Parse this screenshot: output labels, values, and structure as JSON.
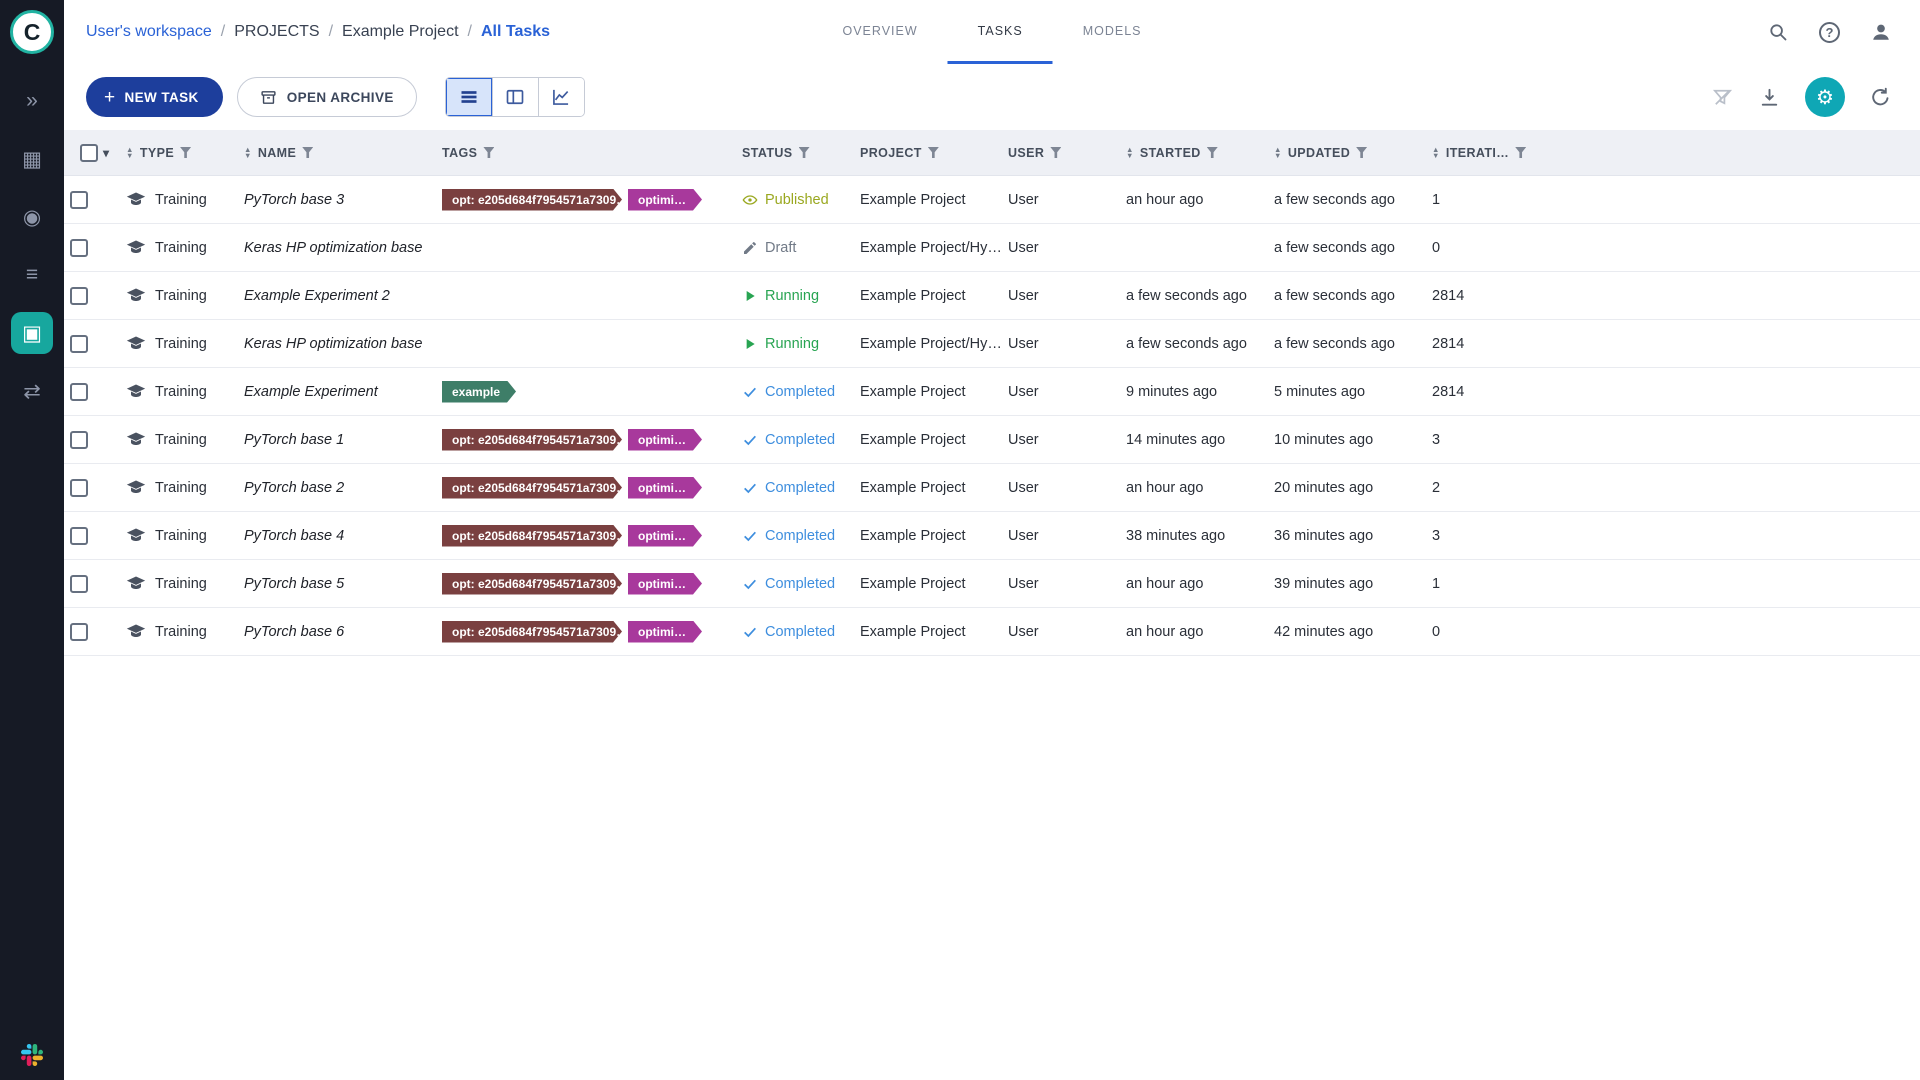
{
  "colors": {
    "sidebar_bg": "#161a25",
    "active_nav_teal": "#17a79e",
    "accent_blue": "#2a62d6",
    "primary_button_blue": "#1d3e9c",
    "gear_teal": "#0fa7b5",
    "tag_maroon": "#7a4040",
    "tag_magenta": "#a8399c",
    "tag_green": "#3e7e68",
    "status_published": "#9aa820",
    "status_draft": "#717a87",
    "status_running": "#28a452",
    "status_completed": "#3e8ede",
    "table_header_bg": "#eef0f5"
  },
  "icons": {
    "plus": "+",
    "caret_down": "▾",
    "sort_up": "▲",
    "sort_down": "▼",
    "help_mark": "?",
    "gear": "⚙"
  },
  "sidebar": {
    "logo_letter": "C",
    "items": [
      {
        "id": "expand",
        "glyph": "»"
      },
      {
        "id": "dashboard",
        "glyph": "▦"
      },
      {
        "id": "projects",
        "glyph": "◉"
      },
      {
        "id": "datasets",
        "glyph": "≡"
      },
      {
        "id": "pipelines",
        "glyph": "▣",
        "active": true
      },
      {
        "id": "workers-queues",
        "glyph": "⇄"
      }
    ]
  },
  "header": {
    "breadcrumb": {
      "separator": "/",
      "items": [
        {
          "label": "User's workspace"
        },
        {
          "label": "PROJECTS"
        },
        {
          "label": "Example Project"
        },
        {
          "label": "All Tasks"
        }
      ]
    },
    "tabs": [
      {
        "label": "OVERVIEW"
      },
      {
        "label": "TASKS"
      },
      {
        "label": "MODELS"
      }
    ],
    "active_tab": "TASKS"
  },
  "toolbar": {
    "new_task_label": "NEW TASK",
    "open_archive_label": "OPEN ARCHIVE"
  },
  "table": {
    "columns": [
      {
        "label": "TYPE"
      },
      {
        "label": "NAME"
      },
      {
        "label": "TAGS"
      },
      {
        "label": "STATUS"
      },
      {
        "label": "PROJECT"
      },
      {
        "label": "USER"
      },
      {
        "label": "STARTED"
      },
      {
        "label": "UPDATED"
      },
      {
        "label": "ITERATI…"
      }
    ],
    "rows": [
      {
        "type": "Training",
        "name": "PyTorch base 3",
        "tags": [
          {
            "label": "opt: e205d684f7954571a7309…",
            "variant": "maroon"
          },
          {
            "label": "optimi…",
            "variant": "magenta"
          }
        ],
        "status": {
          "label": "Published",
          "kind": "published"
        },
        "project": "Example Project",
        "user": "User",
        "started": "an hour ago",
        "updated": "a few seconds ago",
        "iterations": 1
      },
      {
        "type": "Training",
        "name": "Keras HP optimization base",
        "tags": [],
        "status": {
          "label": "Draft",
          "kind": "draft"
        },
        "project": "Example Project/Hy…",
        "user": "User",
        "started": "",
        "updated": "a few seconds ago",
        "iterations": 0
      },
      {
        "type": "Training",
        "name": "Example Experiment 2",
        "tags": [],
        "status": {
          "label": "Running",
          "kind": "running"
        },
        "project": "Example Project",
        "user": "User",
        "started": "a few seconds ago",
        "updated": "a few seconds ago",
        "iterations": 2814
      },
      {
        "type": "Training",
        "name": "Keras HP optimization base",
        "tags": [],
        "status": {
          "label": "Running",
          "kind": "running"
        },
        "project": "Example Project/Hy…",
        "user": "User",
        "started": "a few seconds ago",
        "updated": "a few seconds ago",
        "iterations": 2814
      },
      {
        "type": "Training",
        "name": "Example Experiment",
        "tags": [
          {
            "label": "example",
            "variant": "green"
          }
        ],
        "status": {
          "label": "Completed",
          "kind": "completed"
        },
        "project": "Example Project",
        "user": "User",
        "started": "9 minutes ago",
        "updated": "5 minutes ago",
        "iterations": 2814
      },
      {
        "type": "Training",
        "name": "PyTorch base 1",
        "tags": [
          {
            "label": "opt: e205d684f7954571a7309…",
            "variant": "maroon"
          },
          {
            "label": "optimi…",
            "variant": "magenta"
          }
        ],
        "status": {
          "label": "Completed",
          "kind": "completed"
        },
        "project": "Example Project",
        "user": "User",
        "started": "14 minutes ago",
        "updated": "10 minutes ago",
        "iterations": 3
      },
      {
        "type": "Training",
        "name": "PyTorch base 2",
        "tags": [
          {
            "label": "opt: e205d684f7954571a7309…",
            "variant": "maroon"
          },
          {
            "label": "optimi…",
            "variant": "magenta"
          }
        ],
        "status": {
          "label": "Completed",
          "kind": "completed"
        },
        "project": "Example Project",
        "user": "User",
        "started": "an hour ago",
        "updated": "20 minutes ago",
        "iterations": 2
      },
      {
        "type": "Training",
        "name": "PyTorch base 4",
        "tags": [
          {
            "label": "opt: e205d684f7954571a7309…",
            "variant": "maroon"
          },
          {
            "label": "optimi…",
            "variant": "magenta"
          }
        ],
        "status": {
          "label": "Completed",
          "kind": "completed"
        },
        "project": "Example Project",
        "user": "User",
        "started": "38 minutes ago",
        "updated": "36 minutes ago",
        "iterations": 3
      },
      {
        "type": "Training",
        "name": "PyTorch base 5",
        "tags": [
          {
            "label": "opt: e205d684f7954571a7309…",
            "variant": "maroon"
          },
          {
            "label": "optimi…",
            "variant": "magenta"
          }
        ],
        "status": {
          "label": "Completed",
          "kind": "completed"
        },
        "project": "Example Project",
        "user": "User",
        "started": "an hour ago",
        "updated": "39 minutes ago",
        "iterations": 1
      },
      {
        "type": "Training",
        "name": "PyTorch base 6",
        "tags": [
          {
            "label": "opt: e205d684f7954571a7309…",
            "variant": "maroon"
          },
          {
            "label": "optimi…",
            "variant": "magenta"
          }
        ],
        "status": {
          "label": "Completed",
          "kind": "completed"
        },
        "project": "Example Project",
        "user": "User",
        "started": "an hour ago",
        "updated": "42 minutes ago",
        "iterations": 0
      }
    ]
  }
}
